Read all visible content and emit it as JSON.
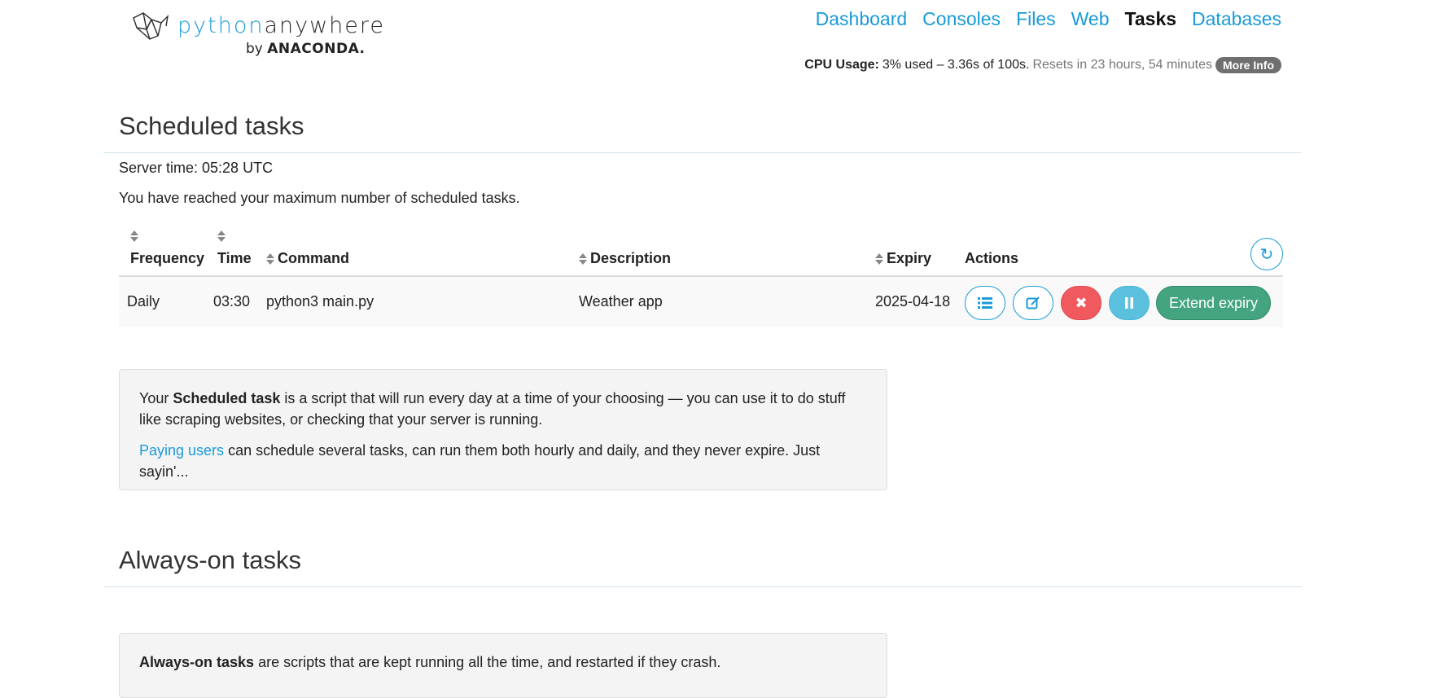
{
  "logo": {
    "word_light": "python",
    "word_dark": "anywhere",
    "by": "by",
    "brand": "ANACONDA."
  },
  "nav": {
    "items": [
      "Dashboard",
      "Consoles",
      "Files",
      "Web",
      "Tasks",
      "Databases"
    ],
    "active": "Tasks"
  },
  "cpu": {
    "label": "CPU Usage:",
    "value": "3% used – 3.36s of 100s.",
    "reset": "Resets in 23 hours, 54 minutes",
    "more_info": "More Info"
  },
  "scheduled": {
    "heading": "Scheduled tasks",
    "server_time": "Server time: 05:28 UTC",
    "limit_msg": "You have reached your maximum number of scheduled tasks.",
    "columns": {
      "frequency": "Frequency",
      "time": "Time",
      "command": "Command",
      "description": "Description",
      "expiry": "Expiry",
      "actions": "Actions"
    },
    "rows": [
      {
        "frequency": "Daily",
        "time": "03:30",
        "command": "python3 main.py",
        "description": "Weather app",
        "expiry": "2025-04-18"
      }
    ],
    "extend_label": "Extend expiry",
    "info": {
      "p1_a": "Your ",
      "p1_b": "Scheduled task",
      "p1_c": " is a script that will run every day at a time of your choosing — you can use it to do stuff like scraping websites, or checking that your server is running.",
      "p2_link": "Paying users",
      "p2_rest": " can schedule several tasks, can run them both hourly and daily, and they never expire. Just sayin'..."
    }
  },
  "always_on": {
    "heading": "Always-on tasks",
    "info_bold": "Always-on tasks",
    "info_rest": " are scripts that are kept running all the time, and restarted if they crash."
  },
  "colors": {
    "accent": "#1a9bd7",
    "danger": "#f05a5f",
    "info": "#5bc0de",
    "success": "#43a47f"
  }
}
